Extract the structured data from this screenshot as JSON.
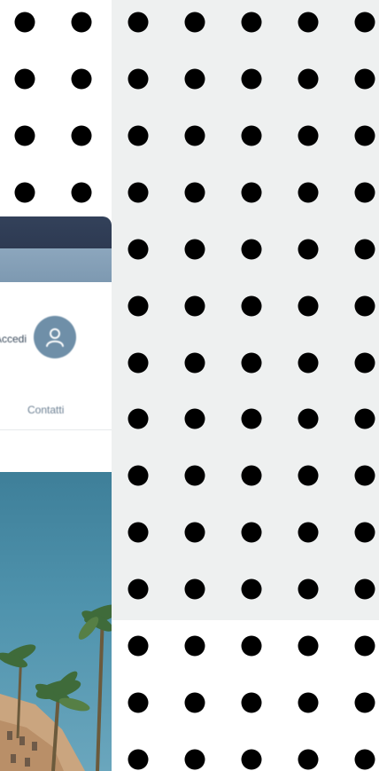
{
  "header": {
    "login_label": "Accedi",
    "avatar_icon": "user-icon",
    "contacts_label": "Contatti"
  },
  "colors": {
    "dark_bar": "#2d3a52",
    "light_bar": "#7d99b1",
    "avatar_bg": "#6f8fa8",
    "sky": "#4f93ad",
    "background_panel": "#eef0f0",
    "dot": "#000000"
  },
  "hero": {
    "image_description_icon": "palm-trees-building-image"
  }
}
